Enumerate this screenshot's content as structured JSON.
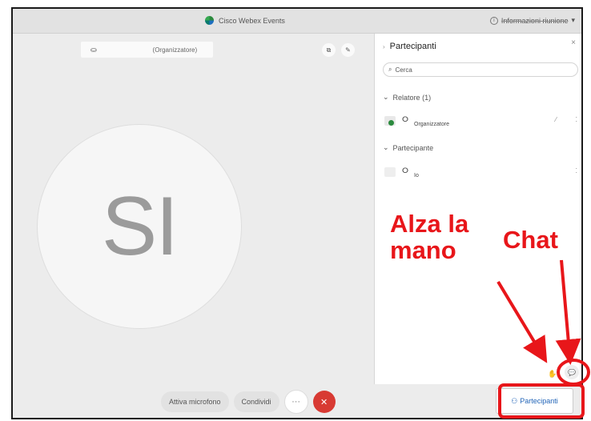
{
  "titlebar": {
    "app_title": "Cisco Webex Events",
    "info_label": "Informazioni riunione",
    "info_chevron": "▾"
  },
  "stage": {
    "host_label": "(Organizzatore)",
    "avatar_initials": "SI"
  },
  "panel": {
    "title": "Partecipanti",
    "close": "×",
    "search_placeholder": "Cerca",
    "sections": [
      {
        "label": "Relatore (1)",
        "rows": [
          {
            "name": "Organizzatore"
          }
        ]
      },
      {
        "label": "Partecipante",
        "rows": [
          {
            "name": "Io"
          }
        ]
      }
    ]
  },
  "controls": {
    "mute_label": "Attiva microfono",
    "share_label": "Condividi",
    "more_label": "···",
    "leave_label": "✕",
    "participants_label": "Partecipanti"
  },
  "annotations": {
    "raise_hand": "Alza la mano",
    "chat": "Chat"
  },
  "colors": {
    "annotation": "#e8161a",
    "leave": "#d83a33",
    "link": "#2466b8"
  },
  "icons": [
    "webex-logo-icon",
    "info-icon",
    "cohost-icon",
    "search-icon",
    "mic-icon",
    "raise-hand-icon",
    "chat-icon",
    "people-icon",
    "close-icon"
  ]
}
